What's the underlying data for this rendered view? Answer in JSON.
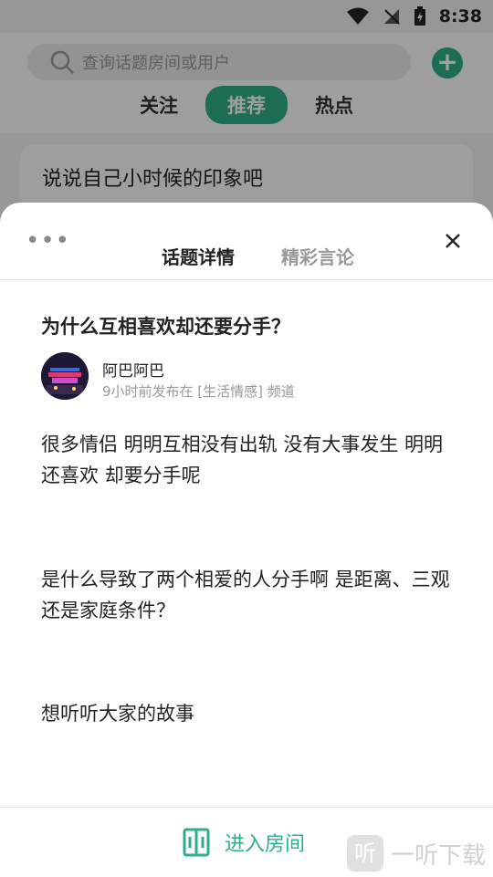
{
  "status_bar": {
    "time": "8:38"
  },
  "search": {
    "placeholder": "查询话题房间或用户"
  },
  "feed_tabs": {
    "follow": "关注",
    "recommend": "推荐",
    "hot": "热点"
  },
  "feed_card": {
    "title": "说说自己小时候的印象吧"
  },
  "sheet": {
    "tabs": {
      "details": "话题详情",
      "highlights": "精彩言论"
    },
    "topic": {
      "title": "为什么互相喜欢却还要分手？",
      "author": "阿巴阿巴",
      "meta": "9小时前发布在 [生活情感] 频道",
      "paragraph1": "很多情侣 明明互相没有出轨 没有大事发生 明明还喜欢 却要分手呢",
      "paragraph2": "是什么导致了两个相爱的人分手啊 是距离、三观还是家庭条件？",
      "paragraph3": "想听听大家的故事"
    },
    "enter_button": "进入房间"
  },
  "watermark": {
    "icon_char": "听",
    "text": "一听下载"
  },
  "colors": {
    "accent": "#2eae8c"
  }
}
